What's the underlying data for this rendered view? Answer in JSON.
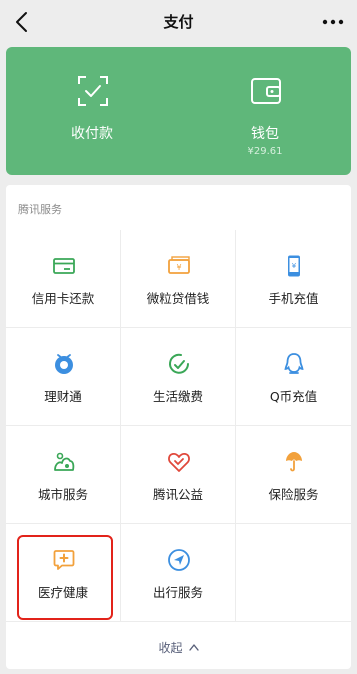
{
  "nav": {
    "title": "支付",
    "back_icon": "chevron-left-icon",
    "more_icon": "more-icon"
  },
  "wallet": {
    "pay": {
      "label": "收付款",
      "icon": "scan-pay-icon"
    },
    "balance": {
      "label": "钱包",
      "amount": "¥29.61",
      "icon": "wallet-icon"
    },
    "background": "#5fb77a"
  },
  "services": {
    "section_title": "腾讯服务",
    "items": [
      {
        "label": "信用卡还款",
        "icon": "credit-card-icon",
        "color": "#3aa757"
      },
      {
        "label": "微粒贷借钱",
        "icon": "loan-icon",
        "color": "#f2a13c"
      },
      {
        "label": "手机充值",
        "icon": "phone-recharge-icon",
        "color": "#3c8fe0"
      },
      {
        "label": "理财通",
        "icon": "wealth-icon",
        "color": "#3c8fe0"
      },
      {
        "label": "生活缴费",
        "icon": "bill-pay-icon",
        "color": "#3aa757"
      },
      {
        "label": "Q币充值",
        "icon": "qq-coin-icon",
        "color": "#3c8fe0"
      },
      {
        "label": "城市服务",
        "icon": "city-service-icon",
        "color": "#3aa757"
      },
      {
        "label": "腾讯公益",
        "icon": "charity-icon",
        "color": "#e0483b"
      },
      {
        "label": "保险服务",
        "icon": "insurance-icon",
        "color": "#f2a13c"
      },
      {
        "label": "医疗健康",
        "icon": "medical-icon",
        "color": "#f2a13c"
      },
      {
        "label": "出行服务",
        "icon": "travel-icon",
        "color": "#3c8fe0"
      }
    ],
    "collapse_label": "收起",
    "highlight_color": "#e2231a"
  }
}
